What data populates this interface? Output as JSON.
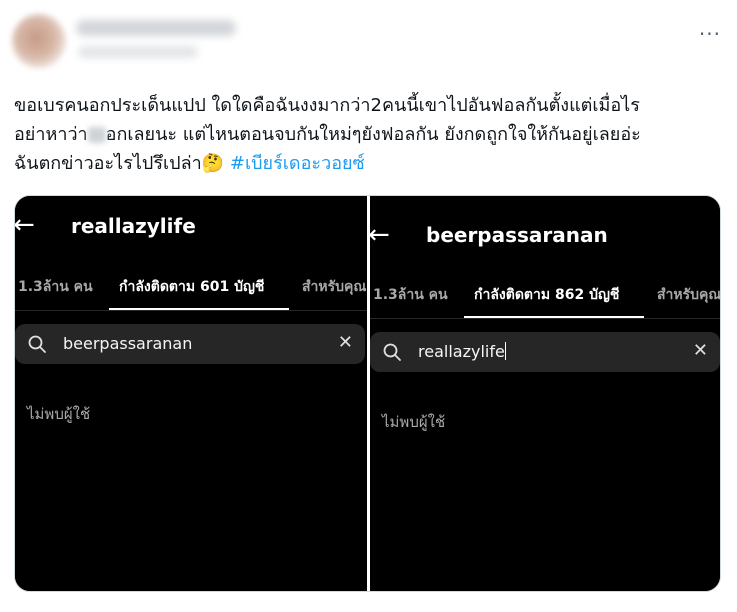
{
  "tweet": {
    "line1": "ขอเบรคนอกประเด็นแปป ใดใดคือฉันงงมากว่า2คนนี้เขาไปอันฟอลกันตั้งแต่เมื่อไร",
    "line2_a": "อย่าหาว่า",
    "line2_b": "อกเลยนะ แต่ไหนตอนจบกันใหม่ๆยังฟอลกัน ยังกดถูกใจให้กันอยู่เลยอ่ะ",
    "line3": "ฉันตกข่าวอะไรไปรึเปล่า",
    "emoji": "🤔",
    "hashtag": "#เบียร์เดอะวอยซ์",
    "more": "···"
  },
  "left": {
    "username": "reallazylife",
    "tab_followers": "1.3ล้าน คน",
    "tab_following": "กำลังติดตาม 601 บัญชี",
    "tab_for_you": "สำหรับคุณ",
    "search_value": "beerpassaranan",
    "no_users": "ไม่พบผู้ใช้"
  },
  "right": {
    "username": "beerpassaranan",
    "tab_followers": "1.3ล้าน คน",
    "tab_following": "กำลังติดตาม 862 บัญชี",
    "tab_for_you": "สำหรับคุณ",
    "search_value": "reallazylife",
    "no_users": "ไม่พบผู้ใช้"
  },
  "icons": {
    "back": "←",
    "clear": "✕"
  },
  "colors": {
    "hashtag": "#1d9bf0",
    "panel_bg": "#000000",
    "search_bg": "#262626"
  }
}
